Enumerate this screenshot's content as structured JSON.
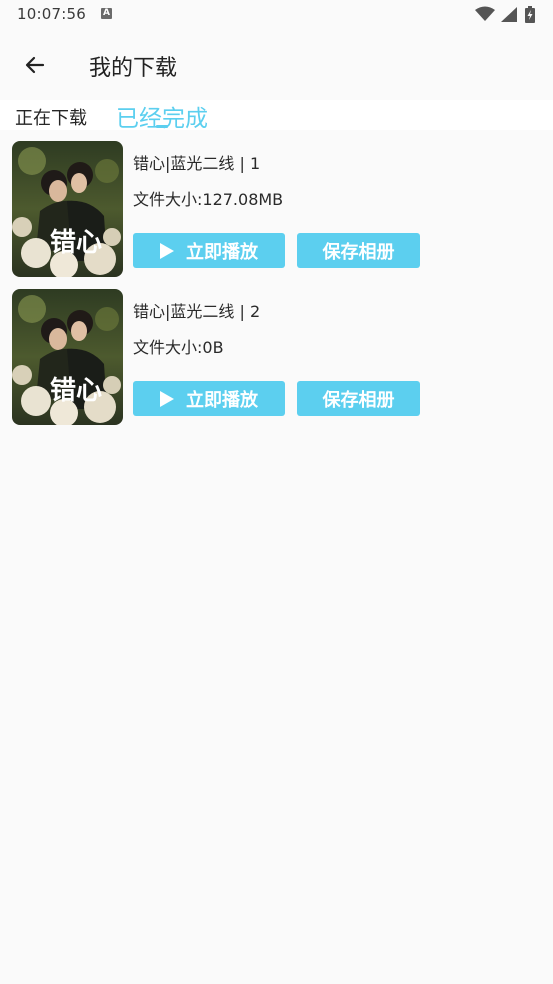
{
  "status_bar": {
    "time": "10:07:56",
    "notification_glyph": "A",
    "icons": [
      "wifi-icon",
      "signal-icon",
      "battery-charging-icon"
    ]
  },
  "toolbar": {
    "back_icon": "arrow-left-icon",
    "title": "我的下载"
  },
  "tabs": [
    {
      "label": "正在下载",
      "active": false
    },
    {
      "label": "已经完成",
      "active": true
    }
  ],
  "accent_color": "#5ccfef",
  "items": [
    {
      "title": "错心|蓝光二线 | 1",
      "size": "文件大小:127.08MB",
      "poster_text": "错心",
      "play_label": "立即播放",
      "save_label": "保存相册"
    },
    {
      "title": "错心|蓝光二线 | 2",
      "size": "文件大小:0B",
      "poster_text": "错心",
      "play_label": "立即播放",
      "save_label": "保存相册"
    }
  ]
}
